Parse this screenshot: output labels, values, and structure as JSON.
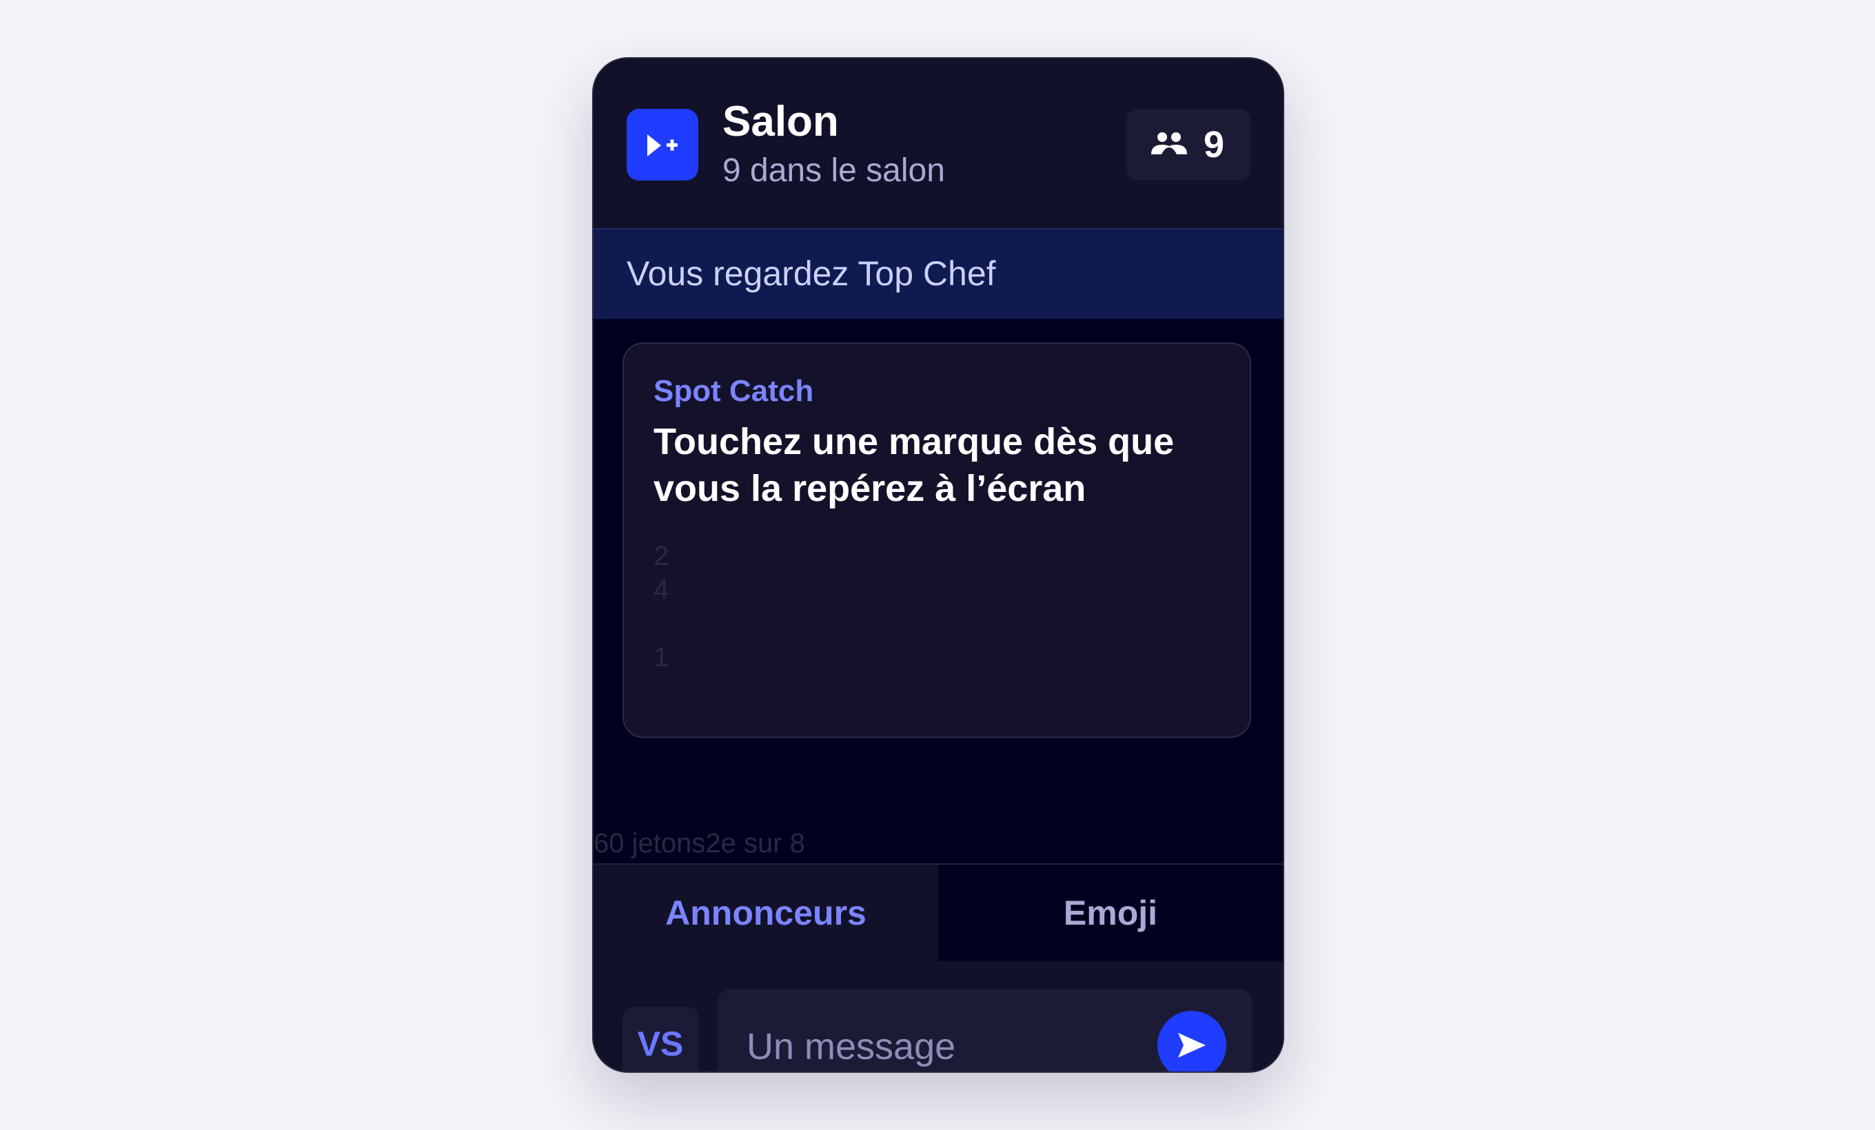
{
  "header": {
    "title": "Salon",
    "subtitle": "9 dans le salon",
    "viewer_count": "9",
    "logo_icon": "play-plus-icon",
    "viewers_icon": "users-icon"
  },
  "banner": {
    "text": "Vous regardez Top Chef"
  },
  "card": {
    "label": "Spot Catch",
    "text": "Touchez une marque dès que vous la repérez à l’écran",
    "numbers": [
      "2",
      "4",
      "",
      "1"
    ]
  },
  "footer_line": "60 jetons2e sur 8",
  "tabs": [
    {
      "label": "Annonceurs",
      "active": true
    },
    {
      "label": "Emoji",
      "active": false
    }
  ],
  "composer": {
    "avatar_initials": "VS",
    "placeholder": "Un message",
    "send_icon": "send-icon"
  },
  "colors": {
    "accent": "#1f3cff",
    "accent_text": "#7b84ff",
    "panel_bg": "#12112a",
    "banner_bg": "#111a4f",
    "page_bg": "#f3f4f8"
  }
}
